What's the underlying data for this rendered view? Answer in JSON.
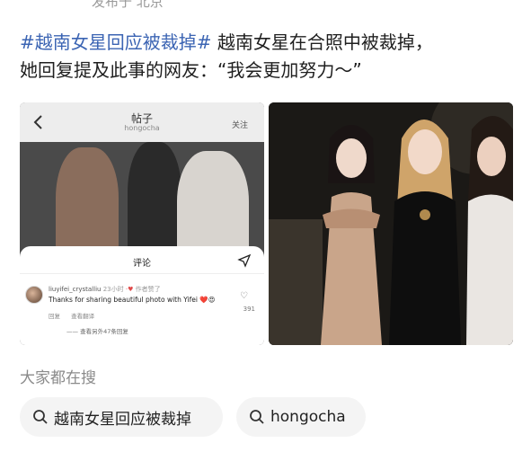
{
  "top_partial": "发布于 北京",
  "post": {
    "hashtag": "#越南女星回应被裁掉#",
    "line1_rest": " 越南女星在合照中被裁掉，",
    "line2": "她回复提及此事的网友：“我会更加努力～”"
  },
  "screenshot": {
    "header_title": "帖子",
    "header_subtitle": "hongocha",
    "follow_label": "关注",
    "sheet_title": "评论",
    "comment": {
      "username": "liuyifei_crystalliu",
      "time": "23小时",
      "badge": "作者赞了",
      "text": "Thanks for sharing beautiful photo with Yifei ❤️😍",
      "reply_label": "回复",
      "translate_label": "查看翻译",
      "more_replies": "查看另外47条回复",
      "like_count": "391"
    }
  },
  "search": {
    "label": "大家都在搜",
    "chips": [
      {
        "label": "越南女星回应被裁掉"
      },
      {
        "label": "hongocha"
      }
    ]
  },
  "colors": {
    "hashtag": "#3b64b3",
    "chip_bg": "#f4f4f4",
    "heart": "#e04a4a"
  }
}
